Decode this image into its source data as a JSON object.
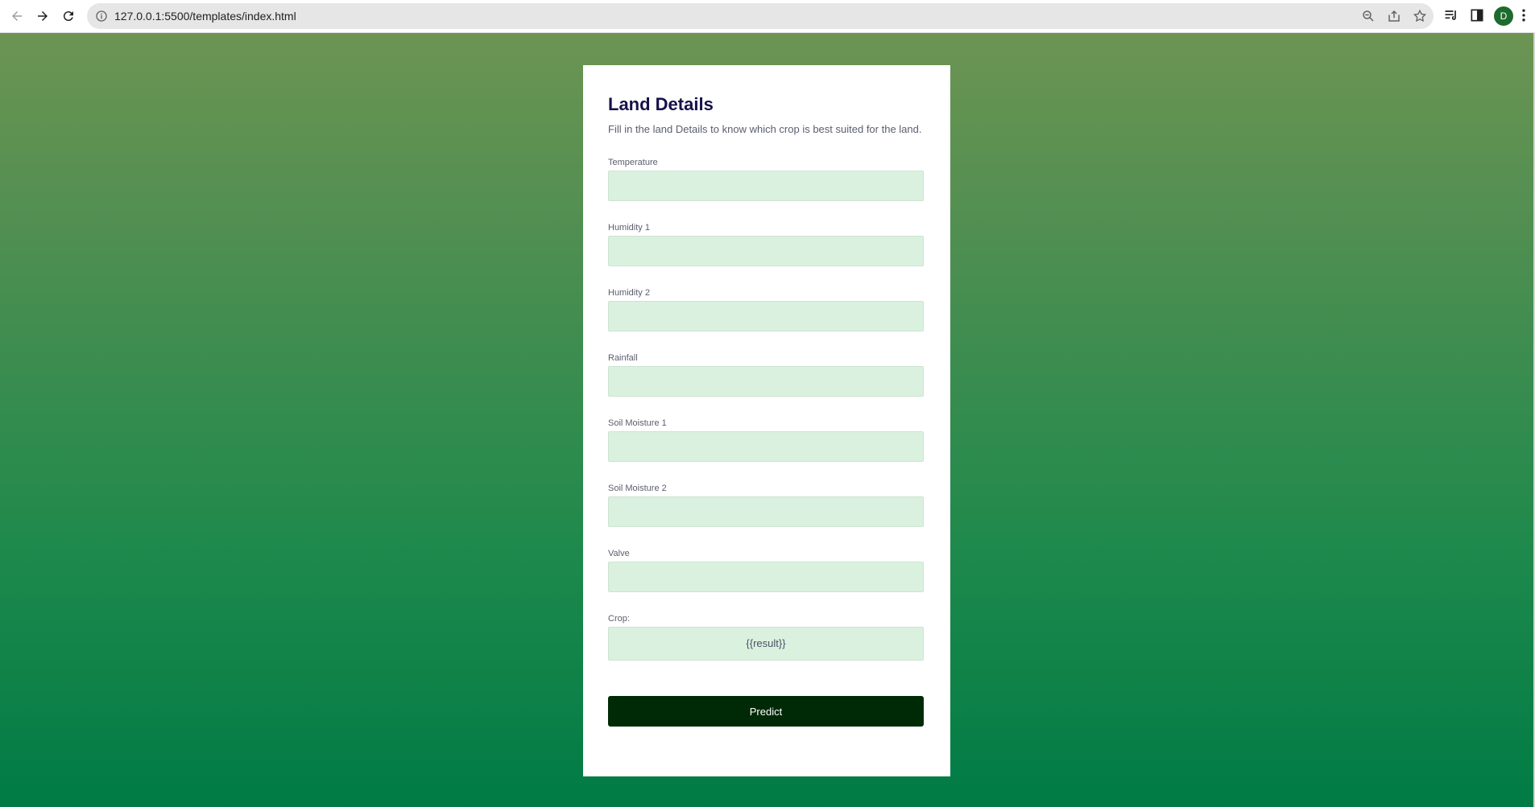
{
  "browser": {
    "url": "127.0.0.1:5500/templates/index.html",
    "avatar_letter": "D",
    "icons": [
      "back-icon",
      "forward-icon",
      "reload-icon",
      "info-icon",
      "zoom-icon",
      "share-icon",
      "bookmark-star-icon",
      "reading-list-icon",
      "side-panel-icon",
      "kebab-menu-icon"
    ]
  },
  "form": {
    "title": "Land Details",
    "description": "Fill in the land Details to know which crop is best suited for the land.",
    "fields": [
      {
        "label": "Temperature",
        "value": ""
      },
      {
        "label": "Humidity 1",
        "value": ""
      },
      {
        "label": "Humidity 2",
        "value": ""
      },
      {
        "label": "Rainfall",
        "value": ""
      },
      {
        "label": "Soil Moisture 1",
        "value": ""
      },
      {
        "label": "Soil Moisture 2",
        "value": ""
      },
      {
        "label": "Valve",
        "value": ""
      }
    ],
    "result_label": "Crop:",
    "result_value": "{{result}}",
    "submit_label": "Predict"
  },
  "colors": {
    "gradient_top": "#6c9453",
    "gradient_bottom": "#007b45",
    "title": "#15124a",
    "input_bg": "#dbf1df",
    "button_bg": "#002a06"
  }
}
